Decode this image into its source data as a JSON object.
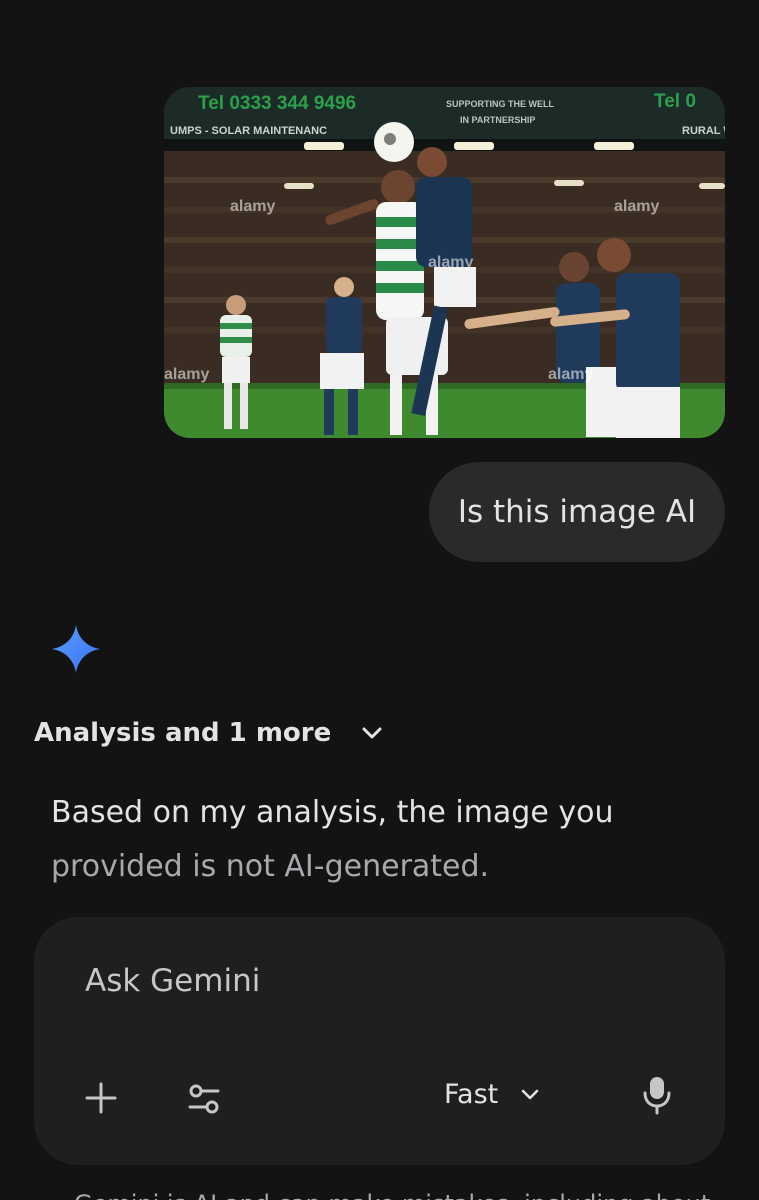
{
  "conversation": {
    "user_image": {
      "icon": "photo-thumbnail",
      "watermark": "alamy",
      "banner_left": "Tel 0333 344 9496",
      "banner_sub_left": "UMPS - SOLAR MAINTENANC",
      "banner_center_1": "SUPPORTING THE WELL",
      "banner_center_2": "IN PARTNERSHIP",
      "banner_right": "Tel 0",
      "banner_sub_right": "RURAL W"
    },
    "user_message": "Is this image AI",
    "response": {
      "section_label": "Analysis and 1 more",
      "text_line1": "Based on my analysis, the image you",
      "text_line2": "provided is not AI-generated."
    }
  },
  "composer": {
    "placeholder": "Ask Gemini",
    "model_label": "Fast"
  },
  "footer": {
    "disclaimer": "Gemini is AI and can make mistakes, including about"
  },
  "colors": {
    "background": "#131314",
    "bubble": "#282a2c",
    "composer": "#1e1f20",
    "spark_blue": "#4a8cf7"
  }
}
